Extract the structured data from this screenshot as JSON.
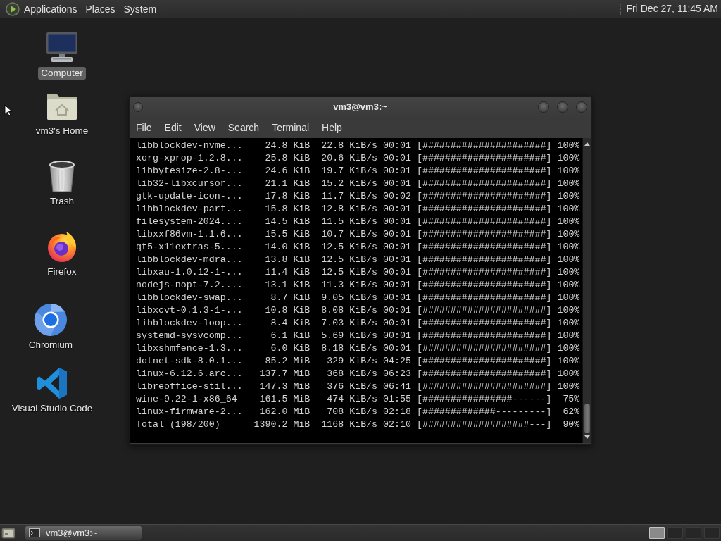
{
  "top_panel": {
    "menus": [
      {
        "label": "Applications"
      },
      {
        "label": "Places"
      },
      {
        "label": "System"
      }
    ],
    "clock": "Fri Dec 27, 11:45 AM"
  },
  "desktop_icons": [
    {
      "label": "Computer",
      "kind": "computer",
      "selected": true
    },
    {
      "label": "vm3's Home",
      "kind": "home",
      "selected": false
    },
    {
      "label": "Trash",
      "kind": "trash",
      "selected": false
    },
    {
      "label": "Firefox",
      "kind": "firefox",
      "selected": false
    },
    {
      "label": "Chromium",
      "kind": "chromium",
      "selected": false
    },
    {
      "label": "Visual Studio Code",
      "kind": "vscode",
      "selected": false
    }
  ],
  "terminal_window": {
    "title": "vm3@vm3:~",
    "menu": [
      "File",
      "Edit",
      "View",
      "Search",
      "Terminal",
      "Help"
    ],
    "rows": [
      {
        "name": "libblockdev-nvme...",
        "size": "24.8 KiB",
        "speed": "22.8 KiB/s",
        "time": "00:01",
        "bar": "[######################]",
        "percent": "100%"
      },
      {
        "name": "xorg-xprop-1.2.8...",
        "size": "25.8 KiB",
        "speed": "20.6 KiB/s",
        "time": "00:01",
        "bar": "[######################]",
        "percent": "100%"
      },
      {
        "name": "libbytesize-2.8-...",
        "size": "24.6 KiB",
        "speed": "19.7 KiB/s",
        "time": "00:01",
        "bar": "[######################]",
        "percent": "100%"
      },
      {
        "name": "lib32-libxcursor...",
        "size": "21.1 KiB",
        "speed": "15.2 KiB/s",
        "time": "00:01",
        "bar": "[######################]",
        "percent": "100%"
      },
      {
        "name": "gtk-update-icon-...",
        "size": "17.8 KiB",
        "speed": "11.7 KiB/s",
        "time": "00:02",
        "bar": "[######################]",
        "percent": "100%"
      },
      {
        "name": "libblockdev-part...",
        "size": "15.8 KiB",
        "speed": "12.8 KiB/s",
        "time": "00:01",
        "bar": "[######################]",
        "percent": "100%"
      },
      {
        "name": "filesystem-2024....",
        "size": "14.5 KiB",
        "speed": "11.5 KiB/s",
        "time": "00:01",
        "bar": "[######################]",
        "percent": "100%"
      },
      {
        "name": "libxxf86vm-1.1.6...",
        "size": "15.5 KiB",
        "speed": "10.7 KiB/s",
        "time": "00:01",
        "bar": "[######################]",
        "percent": "100%"
      },
      {
        "name": "qt5-x11extras-5....",
        "size": "14.0 KiB",
        "speed": "12.5 KiB/s",
        "time": "00:01",
        "bar": "[######################]",
        "percent": "100%"
      },
      {
        "name": "libblockdev-mdra...",
        "size": "13.8 KiB",
        "speed": "12.5 KiB/s",
        "time": "00:01",
        "bar": "[######################]",
        "percent": "100%"
      },
      {
        "name": "libxau-1.0.12-1-...",
        "size": "11.4 KiB",
        "speed": "12.5 KiB/s",
        "time": "00:01",
        "bar": "[######################]",
        "percent": "100%"
      },
      {
        "name": "nodejs-nopt-7.2....",
        "size": "13.1 KiB",
        "speed": "11.3 KiB/s",
        "time": "00:01",
        "bar": "[######################]",
        "percent": "100%"
      },
      {
        "name": "libblockdev-swap...",
        "size": "8.7 KiB",
        "speed": "9.05 KiB/s",
        "time": "00:01",
        "bar": "[######################]",
        "percent": "100%"
      },
      {
        "name": "libxcvt-0.1.3-1-...",
        "size": "10.8 KiB",
        "speed": "8.08 KiB/s",
        "time": "00:01",
        "bar": "[######################]",
        "percent": "100%"
      },
      {
        "name": "libblockdev-loop...",
        "size": "8.4 KiB",
        "speed": "7.03 KiB/s",
        "time": "00:01",
        "bar": "[######################]",
        "percent": "100%"
      },
      {
        "name": "systemd-sysvcomp...",
        "size": "6.1 KiB",
        "speed": "5.69 KiB/s",
        "time": "00:01",
        "bar": "[######################]",
        "percent": "100%"
      },
      {
        "name": "libxshmfence-1.3...",
        "size": "6.0 KiB",
        "speed": "8.18 KiB/s",
        "time": "00:01",
        "bar": "[######################]",
        "percent": "100%"
      },
      {
        "name": "dotnet-sdk-8.0.1...",
        "size": "85.2 MiB",
        "speed": "329 KiB/s",
        "time": "04:25",
        "bar": "[######################]",
        "percent": "100%"
      },
      {
        "name": "linux-6.12.6.arc...",
        "size": "137.7 MiB",
        "speed": "368 KiB/s",
        "time": "06:23",
        "bar": "[######################]",
        "percent": "100%"
      },
      {
        "name": "libreoffice-stil...",
        "size": "147.3 MiB",
        "speed": "376 KiB/s",
        "time": "06:41",
        "bar": "[######################]",
        "percent": "100%"
      },
      {
        "name": "wine-9.22-1-x86_64",
        "size": "161.5 MiB",
        "speed": "474 KiB/s",
        "time": "01:55",
        "bar": "[################------]",
        "percent": "75%"
      },
      {
        "name": "linux-firmware-2...",
        "size": "162.0 MiB",
        "speed": "708 KiB/s",
        "time": "02:18",
        "bar": "[#############---------]",
        "percent": "62%"
      },
      {
        "name": "Total (198/200)",
        "size": "1390.2 MiB",
        "speed": "1168 KiB/s",
        "time": "02:10",
        "bar": "[###################---]",
        "percent": "90%"
      }
    ]
  },
  "taskbar": {
    "windows": [
      {
        "label": "vm3@vm3:~",
        "selected": true
      }
    ],
    "workspaces": [
      {
        "selected": true
      },
      {
        "selected": false
      },
      {
        "selected": false
      },
      {
        "selected": false
      }
    ]
  }
}
